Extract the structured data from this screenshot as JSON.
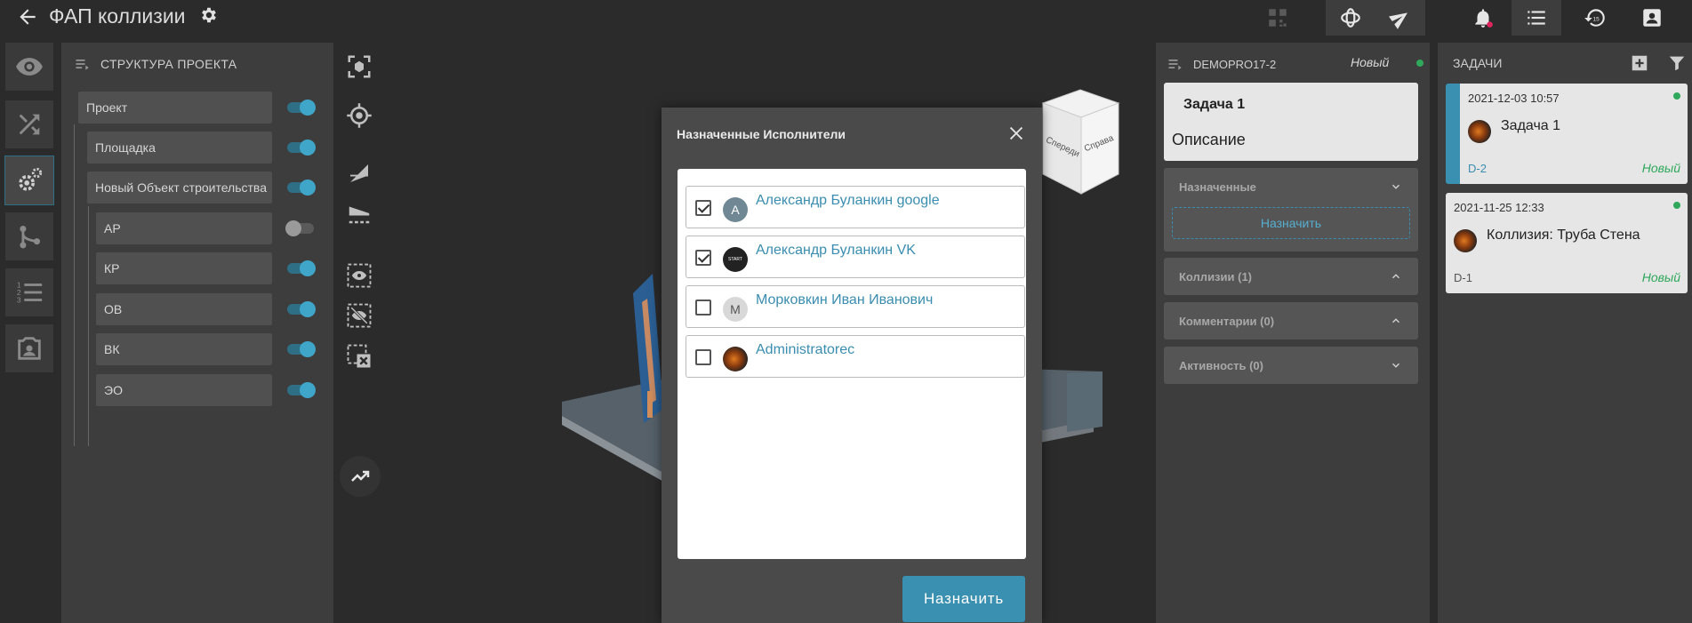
{
  "topbar": {
    "title": "ФАП коллизии",
    "icons": [
      "back-icon",
      "settings-icon",
      "qr-code-icon",
      "orbit-3d-icon",
      "send-plane-icon",
      "bell-icon",
      "list-icon",
      "history-icon",
      "contact-card-icon"
    ]
  },
  "rail": {
    "buttons": [
      "eye-icon",
      "shuffle-icon",
      "settings-cog-icon",
      "branch-icon",
      "numbered-list-icon",
      "portrait-icon"
    ]
  },
  "structure": {
    "heading": "СТРУКТУРА ПРОЕКТА",
    "items": [
      {
        "label": "Проект",
        "on": true
      },
      {
        "label": "Площадка",
        "on": true
      },
      {
        "label": "Новый Объект строительства",
        "on": true
      },
      {
        "label": "АР",
        "on": false
      },
      {
        "label": "КР",
        "on": true
      },
      {
        "label": "ОВ",
        "on": true
      },
      {
        "label": "ВК",
        "on": true
      },
      {
        "label": "ЭО",
        "on": true
      }
    ]
  },
  "viewcube": {
    "front": "Спереди",
    "right": "Справа"
  },
  "modal": {
    "title": "Назначенные Исполнители",
    "people": [
      {
        "name": "Александр Буланкин google",
        "checked": true,
        "avatar": "A"
      },
      {
        "name": "Александр Буланкин VK",
        "checked": true,
        "avatar": "START"
      },
      {
        "name": "Морковкин Иван Иванович",
        "checked": false,
        "avatar": "M"
      },
      {
        "name": "Administratorec",
        "checked": false,
        "avatar": ""
      }
    ],
    "assign_label": "Назначить"
  },
  "detail": {
    "project": "DEMOPRO17-2",
    "status": "Новый",
    "task_title": "Задача 1",
    "description": "Описание",
    "assigned_label": "Назначенные",
    "assign_link": "Назначить",
    "collisions": "Коллизии (1)",
    "comments": "Комментарии (0)",
    "activity": "Активность (0)"
  },
  "tasks": {
    "heading": "ЗАДАЧИ",
    "items": [
      {
        "date": "2021-12-03 10:57",
        "title": "Задача 1",
        "code": "D-2",
        "status": "Новый"
      },
      {
        "date": "2021-11-25 12:33",
        "title": "Коллизия: Труба Стена",
        "code": "D-1",
        "status": "Новый"
      }
    ]
  },
  "colors": {
    "accent": "#3a90b0",
    "status_green": "#2fa85b",
    "panel": "#3d3d3d",
    "background": "#2b2b2b"
  }
}
